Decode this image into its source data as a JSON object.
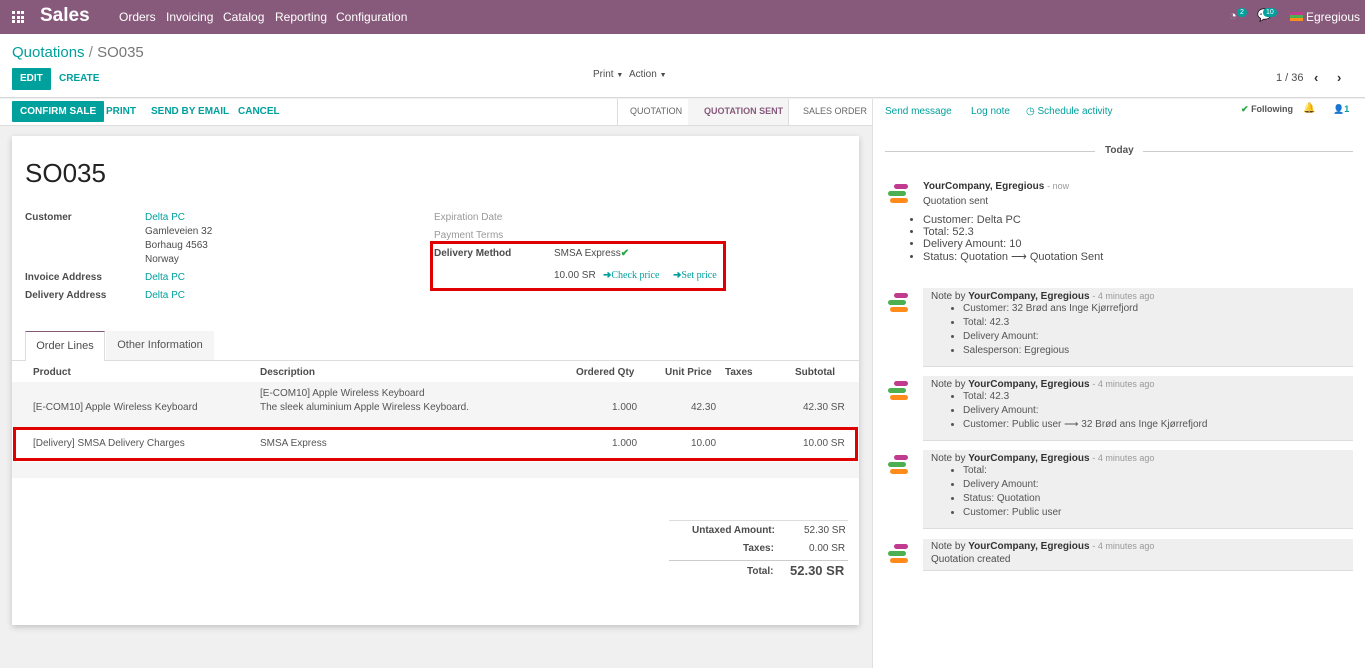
{
  "navbar": {
    "app": "Sales",
    "menu": [
      "Orders",
      "Invoicing",
      "Catalog",
      "Reporting",
      "Configuration"
    ],
    "activity_count": "2",
    "message_count": "10",
    "user": "Egregious"
  },
  "breadcrumb": {
    "parent": "Quotations",
    "separator": "/",
    "current": "SO035"
  },
  "buttons": {
    "edit": "EDIT",
    "create": "CREATE",
    "print": "Print",
    "action": "Action",
    "pager": "1 / 36"
  },
  "statusbar": {
    "confirm": "CONFIRM SALE",
    "print": "PRINT",
    "send_email": "SEND BY EMAIL",
    "cancel": "CANCEL",
    "stages": [
      "QUOTATION",
      "QUOTATION SENT",
      "SALES ORDER"
    ],
    "active_stage": "QUOTATION SENT"
  },
  "form": {
    "name": "SO035",
    "customer_label": "Customer",
    "customer": "Delta PC",
    "address": [
      "Gamleveien 32",
      "Borhaug 4563",
      "Norway"
    ],
    "invoice_label": "Invoice Address",
    "invoice": "Delta PC",
    "delivery_label": "Delivery Address",
    "delivery": "Delta PC",
    "expiration_label": "Expiration Date",
    "payment_label": "Payment Terms",
    "delivery_method_label": "Delivery Method",
    "delivery_method": "SMSA Express",
    "delivery_price": "10.00 SR",
    "check_price": "Check price",
    "set_price": "Set price"
  },
  "tabs": [
    "Order Lines",
    "Other Information"
  ],
  "table": {
    "headers": [
      "Product",
      "Description",
      "Ordered Qty",
      "Unit Price",
      "Taxes",
      "Subtotal"
    ],
    "rows": [
      {
        "product": "[E-COM10] Apple Wireless Keyboard",
        "desc1": "[E-COM10] Apple Wireless Keyboard",
        "desc2": "The sleek aluminium Apple Wireless Keyboard.",
        "qty": "1.000",
        "price": "42.30",
        "taxes": "",
        "subtotal": "42.30 SR"
      },
      {
        "product": "[Delivery] SMSA Delivery Charges",
        "desc1": "SMSA Express",
        "desc2": "",
        "qty": "1.000",
        "price": "10.00",
        "taxes": "",
        "subtotal": "10.00 SR"
      }
    ]
  },
  "totals": {
    "untaxed_label": "Untaxed Amount:",
    "untaxed": "52.30 SR",
    "taxes_label": "Taxes:",
    "taxes": "0.00 SR",
    "total_label": "Total:",
    "total": "52.30 SR"
  },
  "chatter": {
    "send_message": "Send message",
    "log_note": "Log note",
    "schedule": "Schedule activity",
    "following": "Following",
    "followers": "1",
    "today": "Today",
    "messages": [
      {
        "prefix": "",
        "author": "YourCompany, Egregious",
        "time": "- now",
        "body": "Quotation sent",
        "items": [
          "Customer: Delta PC",
          "Total: 52.3",
          "Delivery Amount: 10",
          "Status: Quotation ⟶ Quotation Sent"
        ]
      },
      {
        "prefix": "Note by ",
        "author": "YourCompany, Egregious",
        "time": "- 4 minutes ago",
        "body": "",
        "items": [
          "Customer: 32 Brød ans Inge Kjørrefjord",
          "Total: 42.3",
          "Delivery Amount:",
          "Salesperson: Egregious"
        ]
      },
      {
        "prefix": "Note by ",
        "author": "YourCompany, Egregious",
        "time": "- 4 minutes ago",
        "body": "",
        "items": [
          "Total: 42.3",
          "Delivery Amount:",
          "Customer: Public user ⟶ 32 Brød ans Inge Kjørrefjord"
        ]
      },
      {
        "prefix": "Note by ",
        "author": "YourCompany, Egregious",
        "time": "- 4 minutes ago",
        "body": "",
        "items": [
          "Total:",
          "Delivery Amount:",
          "Status: Quotation",
          "Customer: Public user"
        ]
      },
      {
        "prefix": "Note by ",
        "author": "YourCompany, Egregious",
        "time": "- 4 minutes ago",
        "body": "Quotation created",
        "items": []
      }
    ]
  }
}
